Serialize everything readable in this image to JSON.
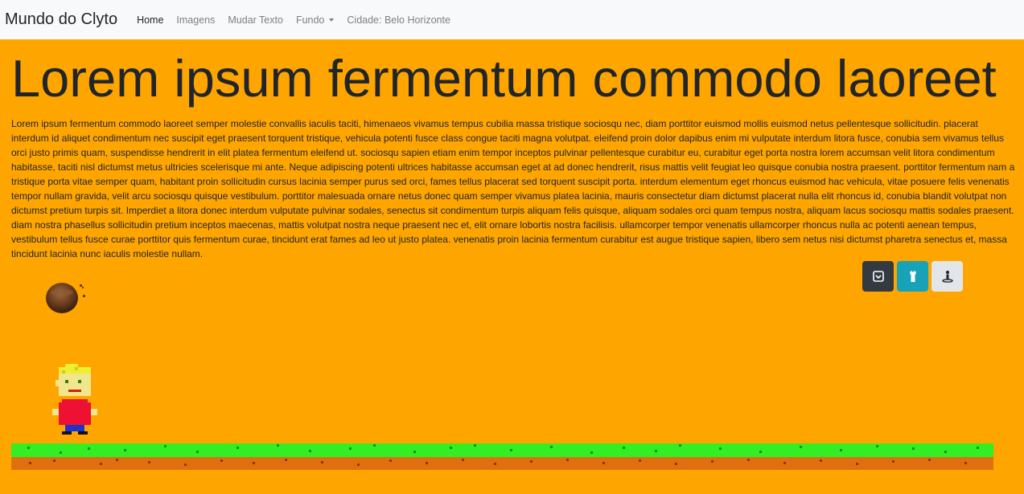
{
  "navbar": {
    "brand": "Mundo do Clyto",
    "links": {
      "home": "Home",
      "imagens": "Imagens",
      "mudar_texto": "Mudar Texto",
      "fundo": "Fundo",
      "cidade": "Cidade: Belo Horizonte"
    }
  },
  "main": {
    "headline": "Lorem ipsum fermentum commodo laoreet",
    "paragraph": "Lorem ipsum fermentum commodo laoreet semper molestie convallis iaculis taciti, himenaeos vivamus tempus cubilia massa tristique sociosqu nec, diam porttitor euismod mollis euismod netus pellentesque sollicitudin. placerat interdum id aliquet condimentum nec suscipit eget praesent torquent tristique, vehicula potenti fusce class congue taciti magna volutpat. eleifend proin dolor dapibus enim mi vulputate interdum litora fusce, conubia sem vivamus tellus orci justo primis quam, suspendisse hendrerit in elit platea fermentum eleifend ut. sociosqu sapien etiam enim tempor inceptos pulvinar pellentesque curabitur eu, curabitur eget porta nostra lorem accumsan velit litora condimentum habitasse, taciti nisl dictumst metus ultricies scelerisque mi ante. Neque adipiscing potenti ultrices habitasse accumsan eget at ad donec hendrerit, risus mattis velit feugiat leo quisque conubia nostra praesent. porttitor fermentum nam a tristique porta vitae semper quam, habitant proin sollicitudin cursus lacinia semper purus sed orci, fames tellus placerat sed torquent suscipit porta. interdum elementum eget rhoncus euismod hac vehicula, vitae posuere felis venenatis tempor nullam gravida, velit arcu sociosqu quisque vestibulum. porttitor malesuada ornare netus donec quam semper vivamus platea lacinia, mauris consectetur diam dictumst placerat nulla elit rhoncus id, conubia blandit volutpat non dictumst pretium turpis sit. Imperdiet a litora donec interdum vulputate pulvinar sodales, senectus sit condimentum turpis aliquam felis quisque, aliquam sodales orci quam tempus nostra, aliquam lacus sociosqu mattis sodales praesent. diam nostra phasellus sollicitudin pretium inceptos maecenas, mattis volutpat nostra neque praesent nec et, elit ornare lobortis nostra facilisis. ullamcorper tempor venenatis ullamcorper rhoncus nulla ac potenti aenean tempus, vestibulum tellus fusce curae porttitor quis fermentum curae, tincidunt erat fames ad leo ut justo platea. venenatis proin lacinia fermentum curabitur est augue tristique sapien, libero sem netus nisi dictumst pharetra senectus et, massa tincidunt lacinia nunc iaculis molestie nullam."
  },
  "action_buttons": [
    {
      "icon": "square-chevron-down-icon",
      "style": "dark"
    },
    {
      "icon": "shirt-icon",
      "style": "info"
    },
    {
      "icon": "person-standing-icon",
      "style": "light"
    }
  ],
  "colors": {
    "page_background": "#ffa500",
    "navbar_background": "#f8f9fa",
    "grass": "#33ee22",
    "dirt": "#e0700f",
    "shirt": "#ee1133",
    "hair": "#eeee33"
  }
}
